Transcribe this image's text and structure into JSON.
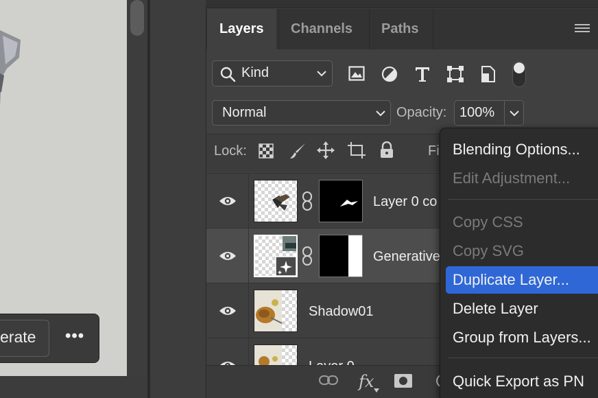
{
  "panel": {
    "tabs": [
      {
        "label": "Layers",
        "active": true
      },
      {
        "label": "Channels",
        "active": false
      },
      {
        "label": "Paths",
        "active": false
      }
    ]
  },
  "filter": {
    "kind_label": "Kind",
    "icons": [
      "pixel-filter-icon",
      "adjustment-filter-icon",
      "type-filter-icon",
      "shape-filter-icon",
      "smart-object-filter-icon"
    ]
  },
  "blend": {
    "mode": "Normal",
    "opacity_label": "Opacity:",
    "opacity_value": "100%"
  },
  "lock": {
    "label": "Lock:",
    "fill_label_partial": "Fi"
  },
  "layers": [
    {
      "name": "Layer 0 co",
      "visible": true,
      "has_mask": true,
      "selected": false
    },
    {
      "name": "Generative",
      "visible": true,
      "has_mask": true,
      "selected": true
    },
    {
      "name": "Shadow01",
      "visible": true,
      "has_mask": false,
      "selected": false
    },
    {
      "name": "Layer 0",
      "visible": true,
      "has_mask": false,
      "selected": false
    }
  ],
  "canvas": {
    "generate_label": "erate",
    "more_label": "•••"
  },
  "footer": {
    "fx_label": "fx"
  },
  "context_menu": {
    "items": [
      {
        "label": "Blending Options...",
        "enabled": true
      },
      {
        "label": "Edit Adjustment...",
        "enabled": false
      },
      {
        "label": "Copy CSS",
        "enabled": false
      },
      {
        "label": "Copy SVG",
        "enabled": false
      },
      {
        "label": "Duplicate Layer...",
        "enabled": true,
        "highlighted": true
      },
      {
        "label": "Delete Layer",
        "enabled": true
      },
      {
        "label": "Group from Layers...",
        "enabled": true
      },
      {
        "label": "Quick Export as PN",
        "enabled": true
      }
    ]
  },
  "colors": {
    "highlight": "#2f67d6",
    "panel_bg": "#404040",
    "menu_bg": "#2c2c2c"
  }
}
